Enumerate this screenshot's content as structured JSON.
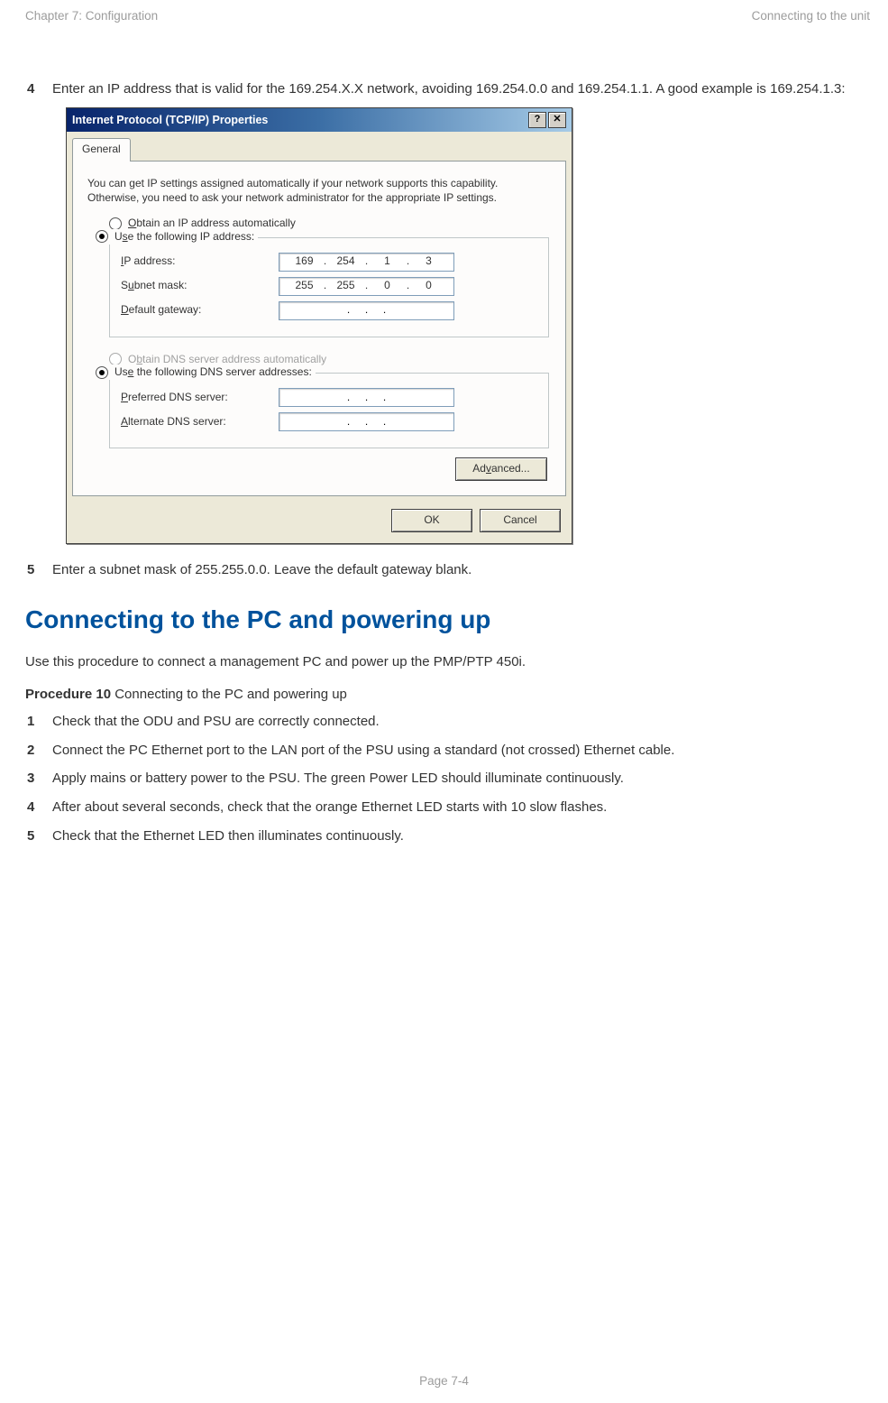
{
  "header": {
    "left": "Chapter 7:  Configuration",
    "right": "Connecting to the unit"
  },
  "steps_a": [
    {
      "n": "4",
      "text": "Enter an IP address that is valid for the 169.254.X.X network, avoiding 169.254.0.0 and 169.254.1.1. A good example is 169.254.1.3:"
    },
    {
      "n": "5",
      "text": "Enter a subnet mask of 255.255.0.0. Leave the default gateway blank."
    }
  ],
  "dialog": {
    "title": "Internet Protocol (TCP/IP) Properties",
    "help_glyph": "?",
    "close_glyph": "✕",
    "tab": "General",
    "intro": "You can get IP settings assigned automatically if your network supports this capability. Otherwise, you need to ask your network administrator for the appropriate IP settings.",
    "opt_auto_ip": "Obtain an IP address automatically",
    "opt_use_ip": "Use the following IP address:",
    "lbl_ip": "IP address:",
    "lbl_subnet": "Subnet mask:",
    "lbl_gateway": "Default gateway:",
    "ip": [
      "169",
      "254",
      "1",
      "3"
    ],
    "subnet": [
      "255",
      "255",
      "0",
      "0"
    ],
    "opt_auto_dns": "Obtain DNS server address automatically",
    "opt_use_dns": "Use the following DNS server addresses:",
    "lbl_pref_dns": "Preferred DNS server:",
    "lbl_alt_dns": "Alternate DNS server:",
    "btn_adv": "Advanced...",
    "btn_ok": "OK",
    "btn_cancel": "Cancel",
    "u": {
      "O": "O",
      "s": "s",
      "I": "I",
      "u": "u",
      "D": "D",
      "b": "b",
      "e": "e",
      "P": "P",
      "A": "A",
      "v": "v"
    }
  },
  "section_title": "Connecting to the PC and powering up",
  "section_lead": "Use this procedure to connect a management PC and power up the PMP/PTP 450i.",
  "proc_label_bold": "Procedure 10",
  "proc_label_rest": "  Connecting to the PC and powering up",
  "steps_b": [
    {
      "n": "1",
      "text": "Check that the ODU and PSU are correctly connected."
    },
    {
      "n": "2",
      "text": "Connect the PC Ethernet port to the LAN port of the PSU using a standard (not crossed) Ethernet cable."
    },
    {
      "n": "3",
      "text": "Apply mains or battery power to the PSU. The green Power LED should illuminate continuously."
    },
    {
      "n": "4",
      "text": "After about several seconds, check that the orange Ethernet LED starts with 10 slow flashes."
    },
    {
      "n": "5",
      "text": "Check that the Ethernet LED then illuminates continuously."
    }
  ],
  "footer": "Page 7-4"
}
